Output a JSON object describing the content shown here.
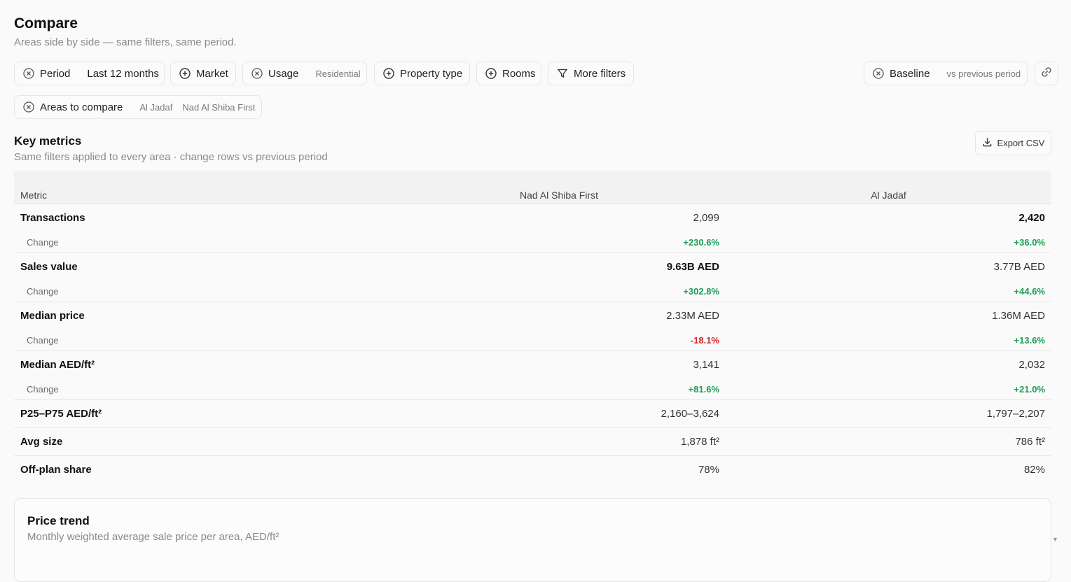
{
  "page": {
    "title": "Compare",
    "subtitle": "Areas side by side — same filters, same period."
  },
  "filters": {
    "period": {
      "label": "Period",
      "value": "Last 12 months"
    },
    "market": {
      "label": "Market"
    },
    "usage": {
      "label": "Usage",
      "value": "Residential"
    },
    "property_type": {
      "label": "Property type"
    },
    "rooms": {
      "label": "Rooms"
    },
    "more_filters": {
      "label": "More filters"
    },
    "baseline": {
      "label": "Baseline",
      "value": "vs previous period"
    },
    "areas": {
      "label": "Areas to compare",
      "values": [
        "Al Jadaf",
        "Nad Al Shiba First"
      ]
    }
  },
  "key_metrics": {
    "title": "Key metrics",
    "subtitle": "Same filters applied to every area · change rows vs previous period",
    "export_label": "Export CSV",
    "columns": [
      "Metric",
      "Nad Al Shiba First",
      "Al Jadaf"
    ],
    "change_label": "Change",
    "rows": [
      {
        "label": "Transactions",
        "values": [
          "2,099",
          "2,420"
        ],
        "changes": [
          "+230.6%",
          "+36.0%"
        ]
      },
      {
        "label": "Sales value",
        "values": [
          "9.63B AED",
          "3.77B AED"
        ],
        "changes": [
          "+302.8%",
          "+44.6%"
        ]
      },
      {
        "label": "Median price",
        "values": [
          "2.33M AED",
          "1.36M AED"
        ],
        "changes": [
          "-18.1%",
          "+13.6%"
        ]
      },
      {
        "label": "Median AED/ft²",
        "values": [
          "3,141",
          "2,032"
        ],
        "changes": [
          "+81.6%",
          "+21.0%"
        ]
      },
      {
        "label": "P25–P75 AED/ft²",
        "values": [
          "2,160–3,624",
          "1,797–2,207"
        ]
      },
      {
        "label": "Avg size",
        "values": [
          "1,878 ft²",
          "786 ft²"
        ]
      },
      {
        "label": "Off-plan share",
        "values": [
          "78%",
          "82%"
        ]
      }
    ]
  },
  "price_trend": {
    "title": "Price trend",
    "subtitle": "Monthly weighted average sale price per area, AED/ft²"
  },
  "colors": {
    "positive": "#1e9e57",
    "negative": "#d8232a"
  },
  "icons": {
    "remove": "circle-x-icon",
    "add": "circle-plus-icon",
    "filter": "funnel-icon",
    "link": "link-icon",
    "download": "download-icon"
  }
}
